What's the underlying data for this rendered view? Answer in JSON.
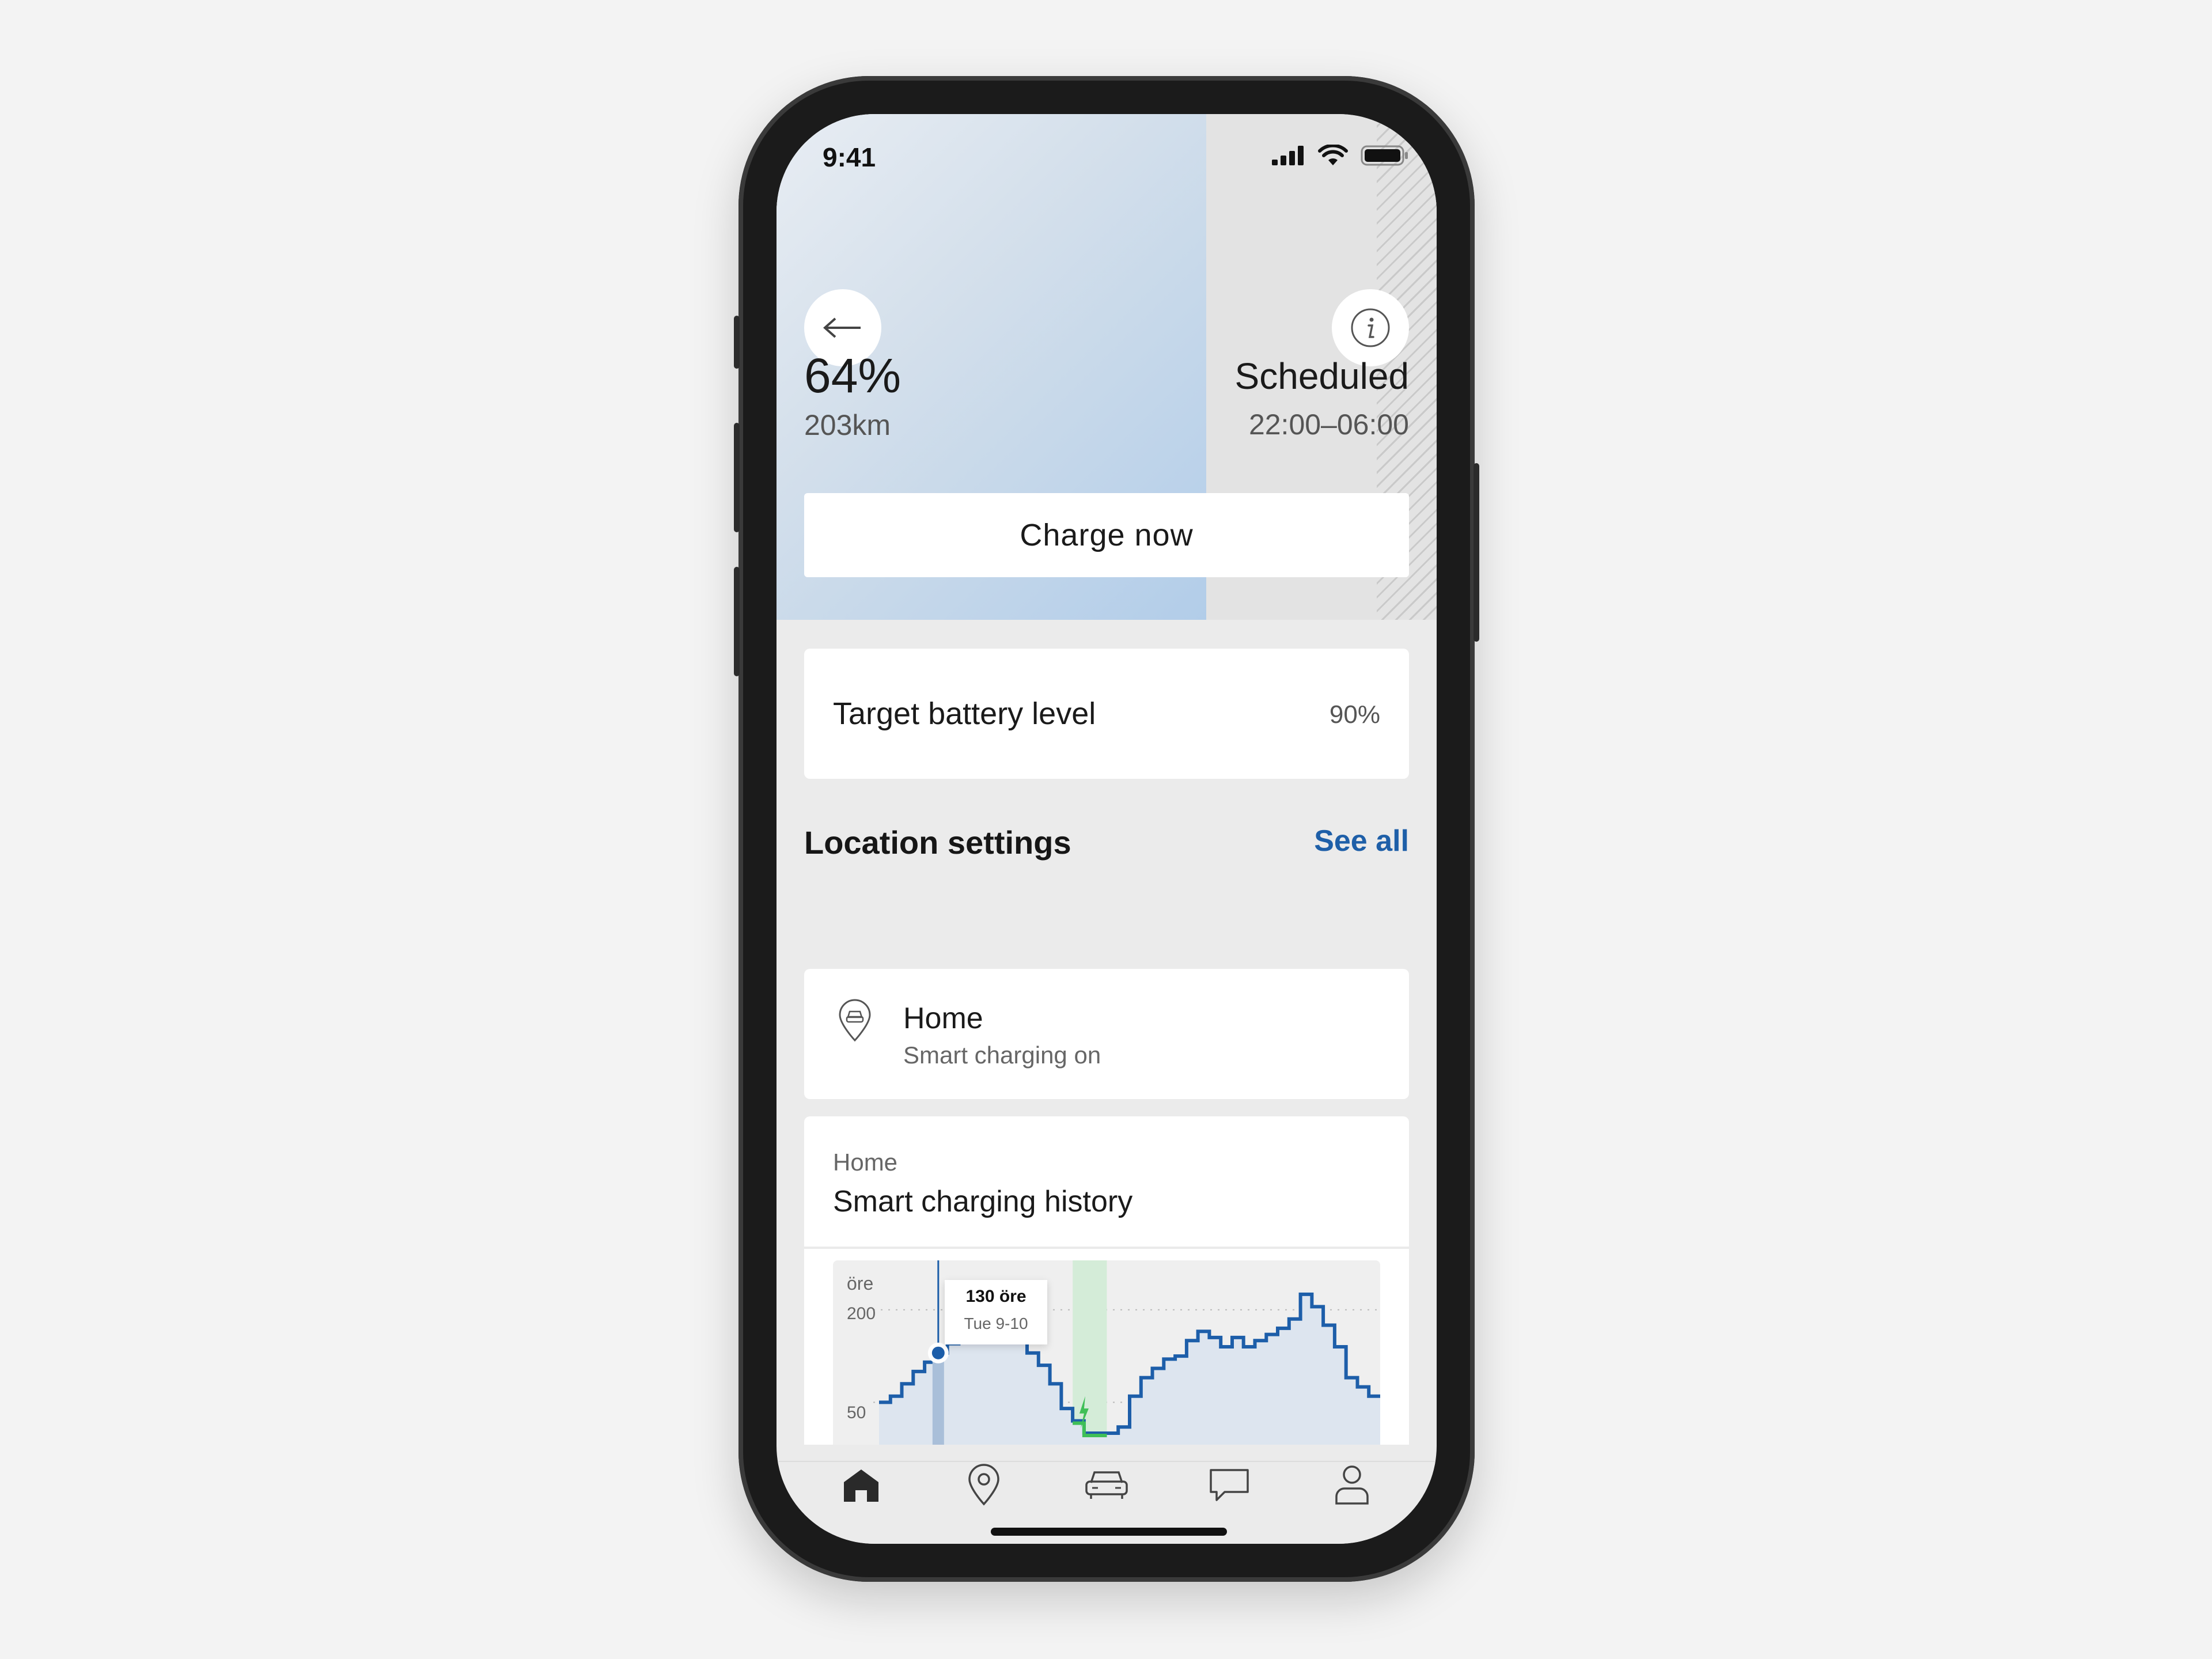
{
  "status_bar": {
    "time": "9:41"
  },
  "hero": {
    "battery_percent": "64%",
    "range": "203km",
    "schedule_status": "Scheduled",
    "schedule_window": "22:00–06:00",
    "charge_button_label": "Charge now",
    "battery_fill_fraction": 0.64
  },
  "target_battery": {
    "label": "Target battery level",
    "value": "90%"
  },
  "location_settings": {
    "title": "Location settings",
    "see_all_label": "See all",
    "items": [
      {
        "name": "Home",
        "status": "Smart charging on"
      }
    ]
  },
  "history_card": {
    "location": "Home",
    "title": "Smart charging history"
  },
  "chart_data": {
    "type": "line",
    "ylabel": "öre",
    "yticks": [
      200,
      50
    ],
    "ylim": [
      0,
      280
    ],
    "tooltip": {
      "value": "130 öre",
      "time": "Tue 9-10"
    },
    "series": [
      {
        "values": [
          50,
          60,
          80,
          100,
          115,
          130,
          145,
          155,
          165,
          190,
          205,
          185,
          160,
          130,
          110,
          80,
          40,
          20,
          0,
          0,
          0,
          10,
          60,
          90,
          105,
          120,
          125,
          150,
          165,
          155,
          140,
          155,
          140,
          150,
          160,
          170,
          185,
          225,
          205,
          175,
          140,
          90,
          75,
          60
        ]
      }
    ],
    "charging_window_index": [
      17,
      19
    ]
  },
  "tab_bar": {
    "items": [
      "home-icon",
      "location-pin-icon",
      "car-icon",
      "chat-icon",
      "profile-icon"
    ]
  }
}
